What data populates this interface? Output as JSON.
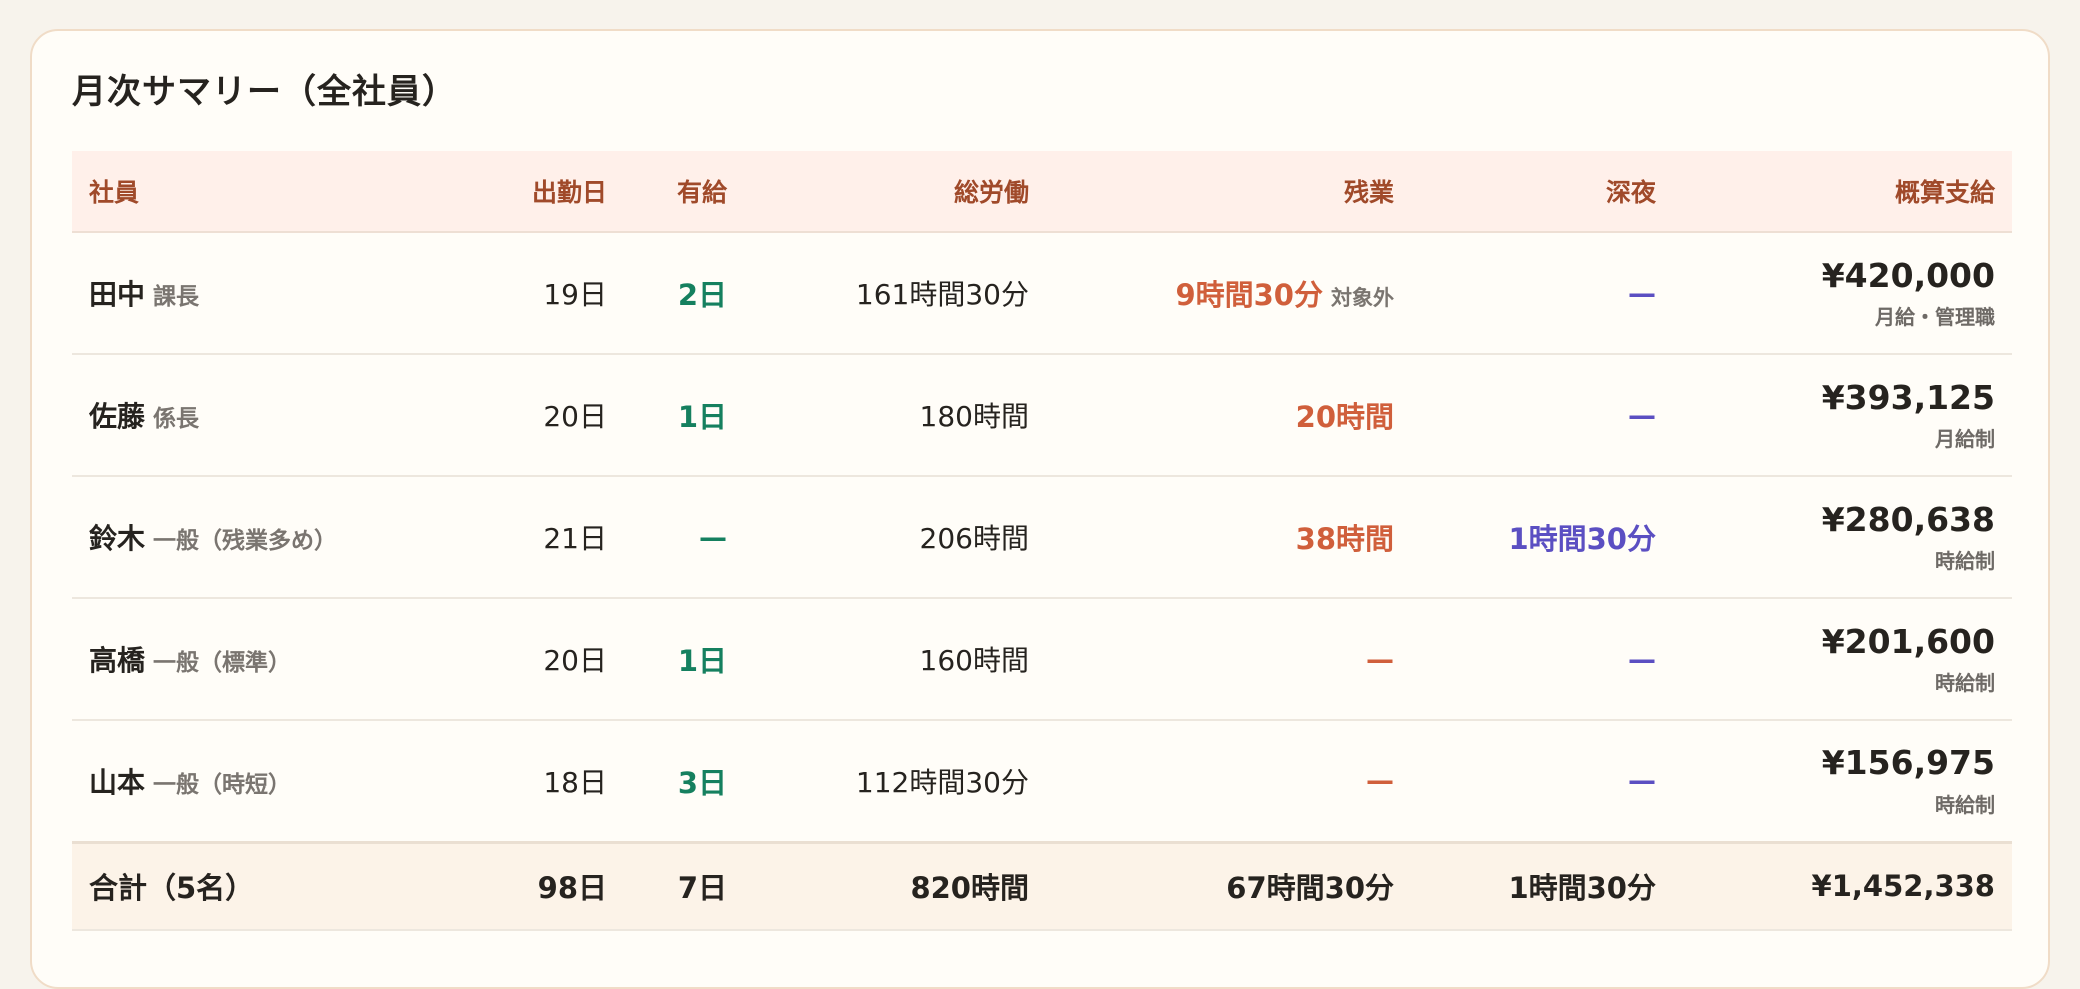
{
  "summary": {
    "title": "月次サマリー（全社員）",
    "headers": {
      "employee": "社員",
      "work_days": "出勤日",
      "paid_leave": "有給",
      "total_work": "総労働",
      "overtime": "残業",
      "late_night": "深夜",
      "estimated_pay": "概算支給"
    },
    "rows": [
      {
        "name": "田中",
        "role": "課長",
        "work_days": "19日",
        "paid_leave": "2日",
        "total_work": "161時間30分",
        "overtime": "9時間30分",
        "overtime_note": "対象外",
        "late_night": "—",
        "pay": "¥420,000",
        "pay_note": "月給・管理職"
      },
      {
        "name": "佐藤",
        "role": "係長",
        "work_days": "20日",
        "paid_leave": "1日",
        "total_work": "180時間",
        "overtime": "20時間",
        "overtime_note": "",
        "late_night": "—",
        "pay": "¥393,125",
        "pay_note": "月給制"
      },
      {
        "name": "鈴木",
        "role": "一般（残業多め）",
        "work_days": "21日",
        "paid_leave": "—",
        "total_work": "206時間",
        "overtime": "38時間",
        "overtime_note": "",
        "late_night": "1時間30分",
        "pay": "¥280,638",
        "pay_note": "時給制"
      },
      {
        "name": "高橋",
        "role": "一般（標準）",
        "work_days": "20日",
        "paid_leave": "1日",
        "total_work": "160時間",
        "overtime": "—",
        "overtime_note": "",
        "late_night": "—",
        "pay": "¥201,600",
        "pay_note": "時給制"
      },
      {
        "name": "山本",
        "role": "一般（時短）",
        "work_days": "18日",
        "paid_leave": "3日",
        "total_work": "112時間30分",
        "overtime": "—",
        "overtime_note": "",
        "late_night": "—",
        "pay": "¥156,975",
        "pay_note": "時給制"
      }
    ],
    "totals": {
      "label": "合計（5名）",
      "work_days": "98日",
      "paid_leave": "7日",
      "total_work": "820時間",
      "overtime": "67時間30分",
      "late_night": "1時間30分",
      "pay": "¥1,452,338"
    },
    "colors": {
      "paid_leave": "#15805f",
      "overtime": "#d05f3b",
      "late_night": "#5b4fc2",
      "header_text": "#a04a2a"
    }
  }
}
